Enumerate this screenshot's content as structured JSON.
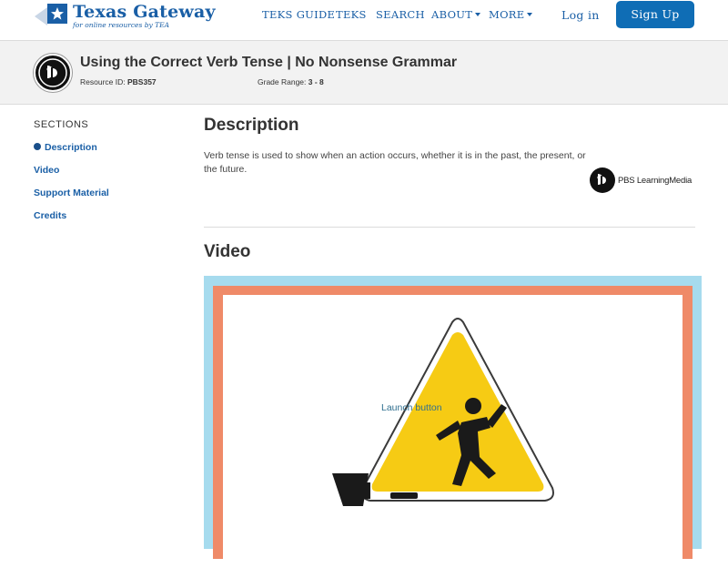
{
  "header": {
    "logo_title": "Texas Gateway",
    "logo_subtitle": "for online resources by TEA",
    "nav": [
      {
        "label": "TEKS GUIDE",
        "dropdown": false
      },
      {
        "label": "TEKS",
        "dropdown": false
      },
      {
        "label": "SEARCH",
        "dropdown": false
      },
      {
        "label": "ABOUT",
        "dropdown": true
      },
      {
        "label": "MORE",
        "dropdown": true
      }
    ],
    "login_label": "Log in",
    "signup_label": "Sign Up"
  },
  "resource": {
    "title": "Using the Correct Verb Tense | No Nonsense Grammar",
    "id_label": "Resource ID:",
    "id_value": "PBS357",
    "grade_label": "Grade Range:",
    "grade_value": "3 - 8"
  },
  "sidebar": {
    "heading": "SECTIONS",
    "items": [
      {
        "label": "Description",
        "active": true
      },
      {
        "label": "Video",
        "active": false
      },
      {
        "label": "Support Material",
        "active": false
      },
      {
        "label": "Credits",
        "active": false
      }
    ]
  },
  "main": {
    "description_heading": "Description",
    "description_text": "Verb tense is used to show when an action occurs, whether it is in the past, the present, or the future.",
    "provider_logo_text": "PBS LearningMedia",
    "video_heading": "Video",
    "launch_button_text": "Launch button"
  },
  "colors": {
    "brand_blue": "#1a5fa6",
    "signup_bg": "#0f6db5",
    "frame_outer": "#a6dbee",
    "frame_mid": "#ef8a68",
    "warning_yellow": "#f6cb14"
  }
}
